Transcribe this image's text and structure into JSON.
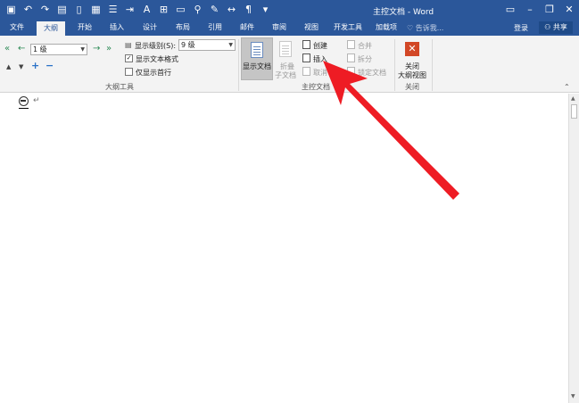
{
  "window": {
    "title": "主控文档 - Word"
  },
  "tabs": [
    {
      "label": "文件",
      "active": false
    },
    {
      "label": "大纲",
      "active": true
    },
    {
      "label": "开始",
      "active": false
    },
    {
      "label": "插入",
      "active": false
    },
    {
      "label": "设计",
      "active": false
    },
    {
      "label": "布局",
      "active": false
    },
    {
      "label": "引用",
      "active": false
    },
    {
      "label": "邮件",
      "active": false
    },
    {
      "label": "审阅",
      "active": false
    },
    {
      "label": "视图",
      "active": false
    },
    {
      "label": "开发工具",
      "active": false
    },
    {
      "label": "加载项",
      "active": false
    }
  ],
  "tell_me": "告诉我...",
  "login": "登录",
  "share": "共享",
  "outline_tools": {
    "level_value": "1 级",
    "show_level_label": "显示级别(S):",
    "show_level_value": "9 级",
    "show_text_format": "显示文本格式",
    "show_first_line": "仅显示首行",
    "group_label": "大纲工具"
  },
  "master_doc": {
    "show_doc": "显示文档",
    "collapse_line1": "折叠",
    "collapse_line2": "子文档",
    "create": "创建",
    "insert": "插入",
    "unlink": "取消",
    "merge": "合并",
    "split": "拆分",
    "lock": "锁定文档",
    "group_label": "主控文档"
  },
  "close_group": {
    "close_line1": "关闭",
    "close_line2": "大纲视图",
    "group_label": "关闭"
  },
  "document": {
    "paragraph_mark": "↵"
  },
  "colors": {
    "titlebar": "#2b579a",
    "arrow": "#ee1c24",
    "close": "#d24726"
  }
}
